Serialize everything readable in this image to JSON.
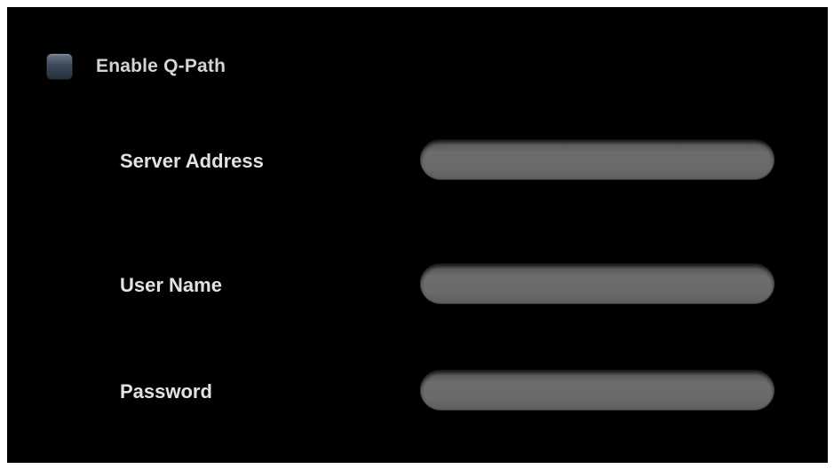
{
  "qpath": {
    "enable_label": "Enable Q-Path",
    "enabled": false
  },
  "fields": {
    "server_address": {
      "label": "Server Address",
      "value": ""
    },
    "user_name": {
      "label": "User Name",
      "value": ""
    },
    "password": {
      "label": "Password",
      "value": ""
    }
  },
  "colors": {
    "background": "#000000",
    "label_text": "#e2e2e2",
    "input_fill": "#6a6a6a",
    "checkbox_fill": "#3b4857"
  }
}
